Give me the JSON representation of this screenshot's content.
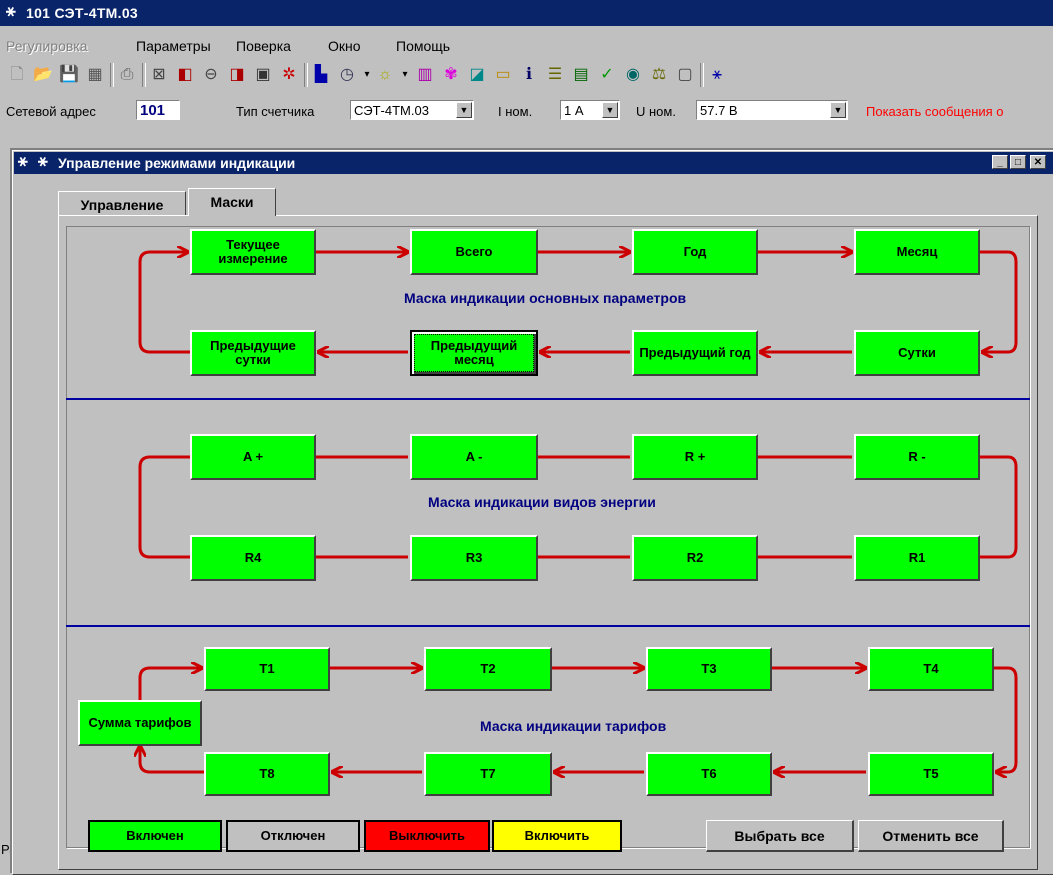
{
  "app": {
    "title": "101  СЭТ-4ТМ.03"
  },
  "menu": [
    {
      "label": "Регулировка",
      "disabled": true
    },
    {
      "label": "Параметры",
      "disabled": false
    },
    {
      "label": "Поверка",
      "disabled": false
    },
    {
      "label": "Окно",
      "disabled": false
    },
    {
      "label": "Помощь",
      "disabled": false
    }
  ],
  "params": {
    "network_address_label": "Сетевой адрес",
    "network_address_value": "101",
    "meter_type_label": "Тип счетчика",
    "meter_type_value": "СЭТ-4ТМ.03",
    "i_nom_label": "I ном.",
    "i_nom_value": "1 А",
    "u_nom_label": "U ном.",
    "u_nom_value": "57.7 В",
    "show_messages_link": "Показать сообщения о"
  },
  "colors": {
    "enabled": "#00ff00",
    "disabled": "#c0c0c0",
    "turn_off": "#ff0000",
    "turn_on": "#ffff00",
    "arrow": "#cc0000",
    "divider": "#0000a0"
  },
  "child_window": {
    "title": "Управление режимами индикации",
    "tabs": [
      {
        "label": "Управление",
        "active": false
      },
      {
        "label": "Маски",
        "active": true
      }
    ]
  },
  "main_params": {
    "title": "Маска индикации основных параметров",
    "top": [
      "Текущее измерение",
      "Всего",
      "Год",
      "Месяц"
    ],
    "bottom": [
      "Предыдущие сутки",
      "Предыдущий месяц",
      "Предыдущий год",
      "Сутки"
    ]
  },
  "energy": {
    "title": "Маска индикации видов энергии",
    "top": [
      "A +",
      "A -",
      "R +",
      "R -"
    ],
    "bottom": [
      "R4",
      "R3",
      "R2",
      "R1"
    ]
  },
  "tariffs": {
    "title": "Маска индикации тарифов",
    "sum": "Сумма тарифов",
    "top": [
      "T1",
      "T2",
      "T3",
      "T4"
    ],
    "bottom": [
      "T8",
      "T7",
      "T6",
      "T5"
    ]
  },
  "legend": {
    "enabled": "Включен",
    "disabled": "Отключен",
    "turn_off": "Выключить",
    "turn_on": "Включить"
  },
  "buttons": {
    "select_all": "Выбрать все",
    "cancel_all": "Отменить все"
  },
  "status_text": "Ра:"
}
